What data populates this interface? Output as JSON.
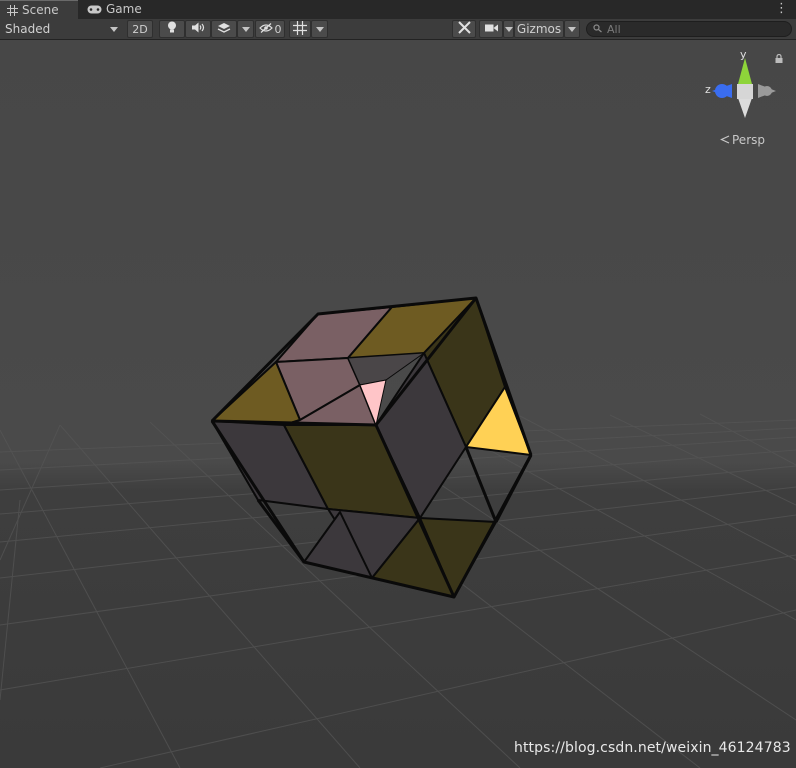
{
  "tabs": [
    {
      "label": "Scene",
      "icon": "grid-icon",
      "active": true
    },
    {
      "label": "Game",
      "icon": "gamepad-icon",
      "active": false
    }
  ],
  "toolbar": {
    "shading_mode": "Shaded",
    "mode_2d": "2D",
    "hidden_count": "0",
    "gizmos_label": "Gizmos",
    "search_placeholder": "All"
  },
  "gizmo": {
    "axis_y": "y",
    "axis_z": "z",
    "projection": "Persp"
  },
  "watermark": "https://blog.csdn.net/weixin_46124783",
  "colors": {
    "tabbar": "#282828",
    "toolbar": "#3c3c3c",
    "viewport": "#484848",
    "face_pink": "#7a6064",
    "face_olive": "#6e5b22",
    "face_dark_olive": "#3a3519",
    "face_dark": "#3c383c",
    "face_yellow": "#ffd155",
    "face_light_pink": "#ffc5c8",
    "axis_y_green": "#8ed43a",
    "axis_z_blue": "#3a6df0"
  }
}
